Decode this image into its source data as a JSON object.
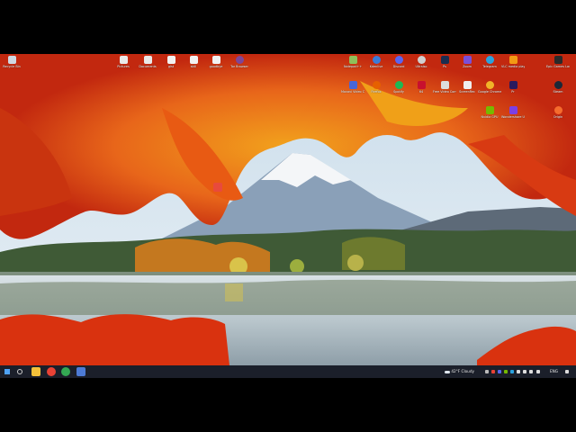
{
  "desktop": {
    "left_icons": [
      {
        "label": "Recycle Bin",
        "icon": "recycle-bin-icon",
        "color": "#cfd8e3"
      },
      {
        "label": "Pictures",
        "icon": "folder-pictures-icon",
        "color": "#e9e9e9"
      },
      {
        "label": "Documents",
        "icon": "folder-documents-icon",
        "color": "#e9e9e9"
      },
      {
        "label": "gist",
        "icon": "file-icon",
        "color": "#f2f2f2"
      },
      {
        "label": "skill",
        "icon": "file-icon",
        "color": "#f2f2f2"
      },
      {
        "label": "goodbye",
        "icon": "file-icon",
        "color": "#f2f2f2"
      },
      {
        "label": "Tor Browser",
        "icon": "tor-browser-icon",
        "color": "#7d4698"
      }
    ],
    "right_icons_row1": [
      {
        "label": "Notepad++",
        "icon": "notepadpp-icon",
        "color": "#8fbf5a"
      },
      {
        "label": "Kdenlive",
        "icon": "kdenlive-icon",
        "color": "#3b7bd6"
      },
      {
        "label": "Discord",
        "icon": "discord-icon",
        "color": "#5865f2"
      },
      {
        "label": "Ultraiso",
        "icon": "ultraiso-icon",
        "color": "#d0d0d0"
      },
      {
        "label": "Ps",
        "icon": "photoshop-icon",
        "color": "#1b2d50"
      },
      {
        "label": "Zoom",
        "icon": "zoom-icon",
        "color": "#7a4fd8"
      },
      {
        "label": "Telegram",
        "icon": "telegram-icon",
        "color": "#2aa3df"
      },
      {
        "label": "VLC media player",
        "icon": "vlc-icon",
        "color": "#f29a14"
      },
      {
        "label": "Epic Games Launcher",
        "icon": "epic-games-icon",
        "color": "#2a2a2a"
      }
    ],
    "right_icons_row2": [
      {
        "label": "Movavi Video Converter",
        "icon": "movavi-icon",
        "color": "#4866d9"
      },
      {
        "label": "Firefox",
        "icon": "firefox-icon",
        "color": "#e66000"
      },
      {
        "label": "Spotify",
        "icon": "spotify-icon",
        "color": "#1db954"
      },
      {
        "label": "64",
        "icon": "aida64-icon",
        "color": "#c8102e"
      },
      {
        "label": "Free Video Converter",
        "icon": "video-converter-icon",
        "color": "#dcdcdc"
      },
      {
        "label": "ScreenRec",
        "icon": "screenrec-icon",
        "color": "#efefef"
      },
      {
        "label": "Google Chrome",
        "icon": "chrome-icon",
        "color": "#f0b429"
      },
      {
        "label": "Pr",
        "icon": "premiere-icon",
        "color": "#2a1a5e"
      },
      {
        "label": "Steam",
        "icon": "steam-icon",
        "color": "#1b2838"
      }
    ],
    "right_icons_row3": [
      {
        "label": "Nvidia GPU",
        "icon": "nvidia-icon",
        "color": "#76b900"
      },
      {
        "label": "Wondershare UniConverter",
        "icon": "uniconverter-icon",
        "color": "#7b3fe4"
      },
      {
        "label": "Origin",
        "icon": "origin-icon",
        "color": "#f56c2d"
      }
    ],
    "center_icon": {
      "label": "",
      "icon": "shortcut-icon",
      "color": "#e84a3c"
    }
  },
  "taskbar": {
    "buttons": [
      {
        "name": "start-icon",
        "color": "#4fa3f7"
      },
      {
        "name": "search-icon",
        "color": "#cfcfcf"
      },
      {
        "name": "file-explorer-icon",
        "color": "#f3c13a"
      },
      {
        "name": "chrome-taskbar-icon",
        "color": "#e94235"
      },
      {
        "name": "chrome-profile-taskbar-icon",
        "color": "#34a853"
      },
      {
        "name": "app-taskbar-icon",
        "color": "#4d7bd6"
      }
    ],
    "weather": {
      "temp": "42°F",
      "condition": "Cloudy"
    },
    "language": "ENG"
  }
}
